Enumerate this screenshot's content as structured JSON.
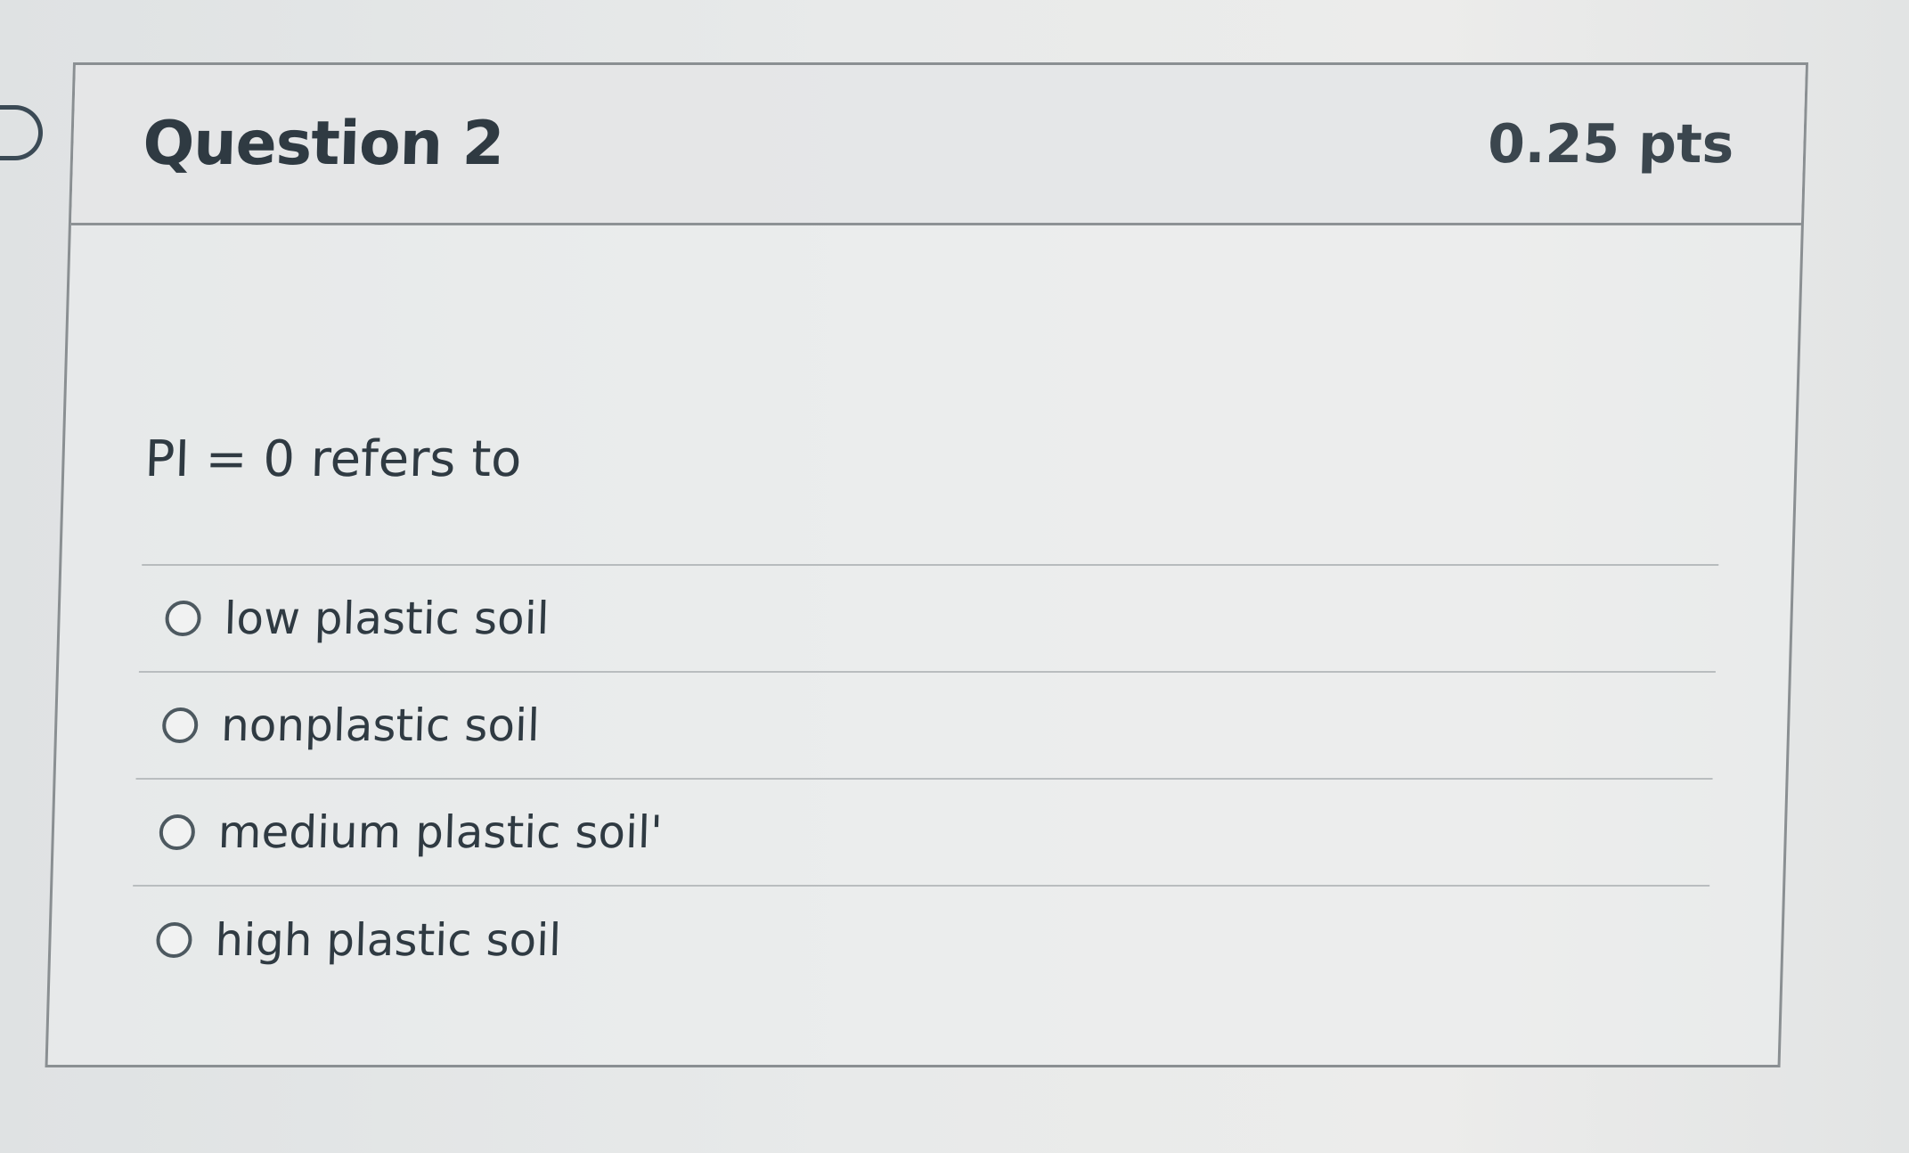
{
  "question": {
    "title": "Question 2",
    "points": "0.25 pts",
    "text": "PI = 0 refers to"
  },
  "answers": [
    {
      "label": "low plastic soil",
      "selected": false
    },
    {
      "label": "nonplastic soil",
      "selected": false
    },
    {
      "label": "medium plastic soil'",
      "selected": false
    },
    {
      "label": "high plastic soil",
      "selected": false
    }
  ],
  "colors": {
    "text": "#2f3a42",
    "border": "#8a8f92",
    "header_bg": "#e4e6e7"
  }
}
